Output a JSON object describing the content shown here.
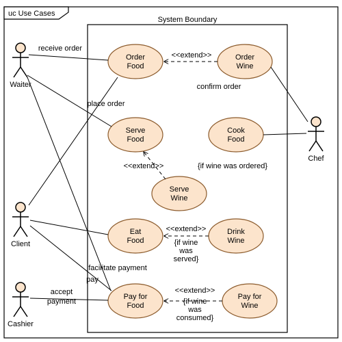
{
  "diagram_title": "uc Use Cases",
  "boundary_label": "System Boundary",
  "actors": {
    "waiter": "Waiter",
    "chef": "Chef",
    "client": "Client",
    "cashier": "Cashier"
  },
  "usecases": {
    "order_food": "Order\nFood",
    "order_wine": "Order\nWine",
    "serve_food": "Serve\nFood",
    "cook_food": "Cook\nFood",
    "serve_wine": "Serve\nWine",
    "eat_food": "Eat\nFood",
    "drink_wine": "Drink\nWine",
    "pay_food": "Pay for\nFood",
    "pay_wine": "Pay for\nWine"
  },
  "relations": {
    "receive_order": "receive order",
    "place_order": "place order",
    "confirm_order": "confirm order",
    "extend1": "<<extend>>",
    "extend2": "<<extend>>",
    "extend3": "<<extend>>",
    "extend4": "<<extend>>",
    "guard_serve": "{if wine was ordered}",
    "guard_drink": "{if wine\nwas\nserved}",
    "guard_pay": "{if wine\nwas\nconsumed}",
    "facilitate": "facilitate payment",
    "pay": "pay",
    "accept_payment": "accept\npayment"
  },
  "chart_data": {
    "type": "use-case-diagram",
    "actors": [
      "Waiter",
      "Chef",
      "Client",
      "Cashier"
    ],
    "use_cases": [
      "Order Food",
      "Order Wine",
      "Serve Food",
      "Cook Food",
      "Serve Wine",
      "Eat Food",
      "Drink Wine",
      "Pay for Food",
      "Pay for Wine"
    ],
    "associations": [
      {
        "actor": "Waiter",
        "use_case": "Order Food",
        "label": "receive order"
      },
      {
        "actor": "Waiter",
        "use_case": "Serve Food"
      },
      {
        "actor": "Waiter",
        "use_case": "Pay for Food",
        "label": "facilitate payment"
      },
      {
        "actor": "Client",
        "use_case": "Order Food",
        "label": "place order"
      },
      {
        "actor": "Client",
        "use_case": "Eat Food"
      },
      {
        "actor": "Client",
        "use_case": "Pay for Food",
        "label": "pay"
      },
      {
        "actor": "Chef",
        "use_case": "Order Wine",
        "label": "confirm order"
      },
      {
        "actor": "Chef",
        "use_case": "Cook Food"
      },
      {
        "actor": "Cashier",
        "use_case": "Pay for Food",
        "label": "accept payment"
      }
    ],
    "extends": [
      {
        "from": "Order Wine",
        "to": "Order Food"
      },
      {
        "from": "Serve Wine",
        "to": "Serve Food",
        "guard": "if wine was ordered"
      },
      {
        "from": "Drink Wine",
        "to": "Eat Food",
        "guard": "if wine was served"
      },
      {
        "from": "Pay for Wine",
        "to": "Pay for Food",
        "guard": "if wine was consumed"
      }
    ]
  }
}
